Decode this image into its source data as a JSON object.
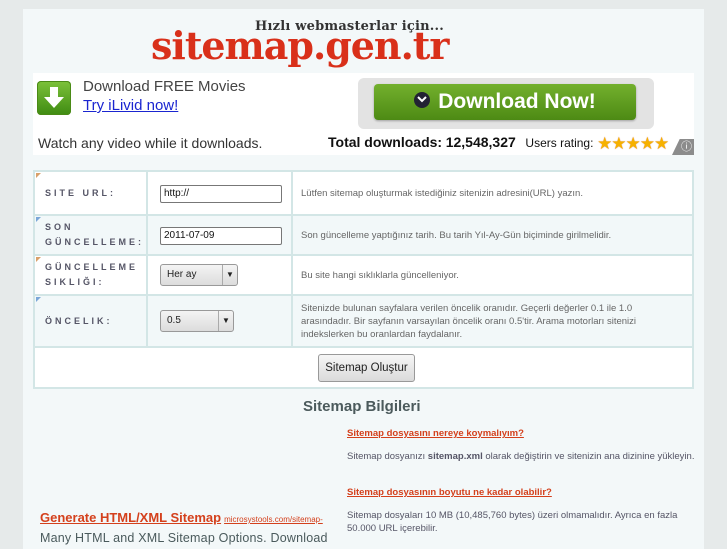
{
  "header": {
    "tagline": "Hızlı webmasterlar için...",
    "logo": "sitemap.gen.tr"
  },
  "ad": {
    "icon": "download-arrow-icon",
    "title": "Download FREE Movies",
    "link": "Try iLivid now!",
    "subtitle": "Watch any video while it downloads.",
    "button": "Download Now!",
    "total_label": "Total downloads:",
    "total_value": "12,548,327",
    "rating_label": "Users rating:",
    "rating_stars": 5,
    "stars": "★★★★★",
    "info_icon": "ⓘ",
    "accent": "#5c9a1f"
  },
  "form": {
    "rows": [
      {
        "label": "SITE URL:",
        "type": "text",
        "value": "http://",
        "desc": "Lütfen sitemap oluşturmak istediğiniz sitenizin adresini(URL) yazın."
      },
      {
        "label": "SON GÜNCELLEME:",
        "type": "text",
        "value": "2011-07-09",
        "desc": "Son güncelleme yaptığınız tarih. Bu tarih Yıl-Ay-Gün biçiminde girilmelidir."
      },
      {
        "label": "GÜNCELLEME SIKLIĞI:",
        "type": "select",
        "value": "Her ay",
        "desc": "Bu site hangi sıklıklarla güncelleniyor."
      },
      {
        "label": "ÖNCELIK:",
        "type": "select",
        "value": "0.5",
        "desc": "Sitenizde bulunan sayfalara verilen öncelik oranıdır. Geçerli değerler 0.1 ile 1.0 arasındadır. Bir sayfanın varsayılan öncelik oranı 0.5'tir. Arama motorları sitenizi indekslerken bu oranlardan faydalanır."
      }
    ],
    "submit": "Sitemap Oluştur"
  },
  "info": {
    "title": "Sitemap Bilgileri",
    "items": [
      {
        "q": "Sitemap dosyasını nereye koymalıyım?",
        "a_pre": "Sitemap dosyanızı ",
        "a_bold": "sitemap.xml",
        "a_post": " olarak değiştirin ve sitenizin ana dizinine yükleyin."
      },
      {
        "q": "Sitemap dosyasının boyutu ne kadar olabilir?",
        "a_pre": "Sitemap dosyaları 10 MB (10,485,760 bytes) üzeri olmamalıdır. Ayrıca en fazla 50.000 URL içerebilir.",
        "a_bold": "",
        "a_post": ""
      }
    ]
  },
  "sponsor": {
    "link": "Generate HTML/XML Sitemap",
    "url": "microsystools.com/sitemap-",
    "desc": "Many HTML and XML Sitemap Options. Download"
  },
  "colors": {
    "logo": "#d9301a",
    "link": "#d4401c",
    "table_border": "#d3e6e6"
  }
}
